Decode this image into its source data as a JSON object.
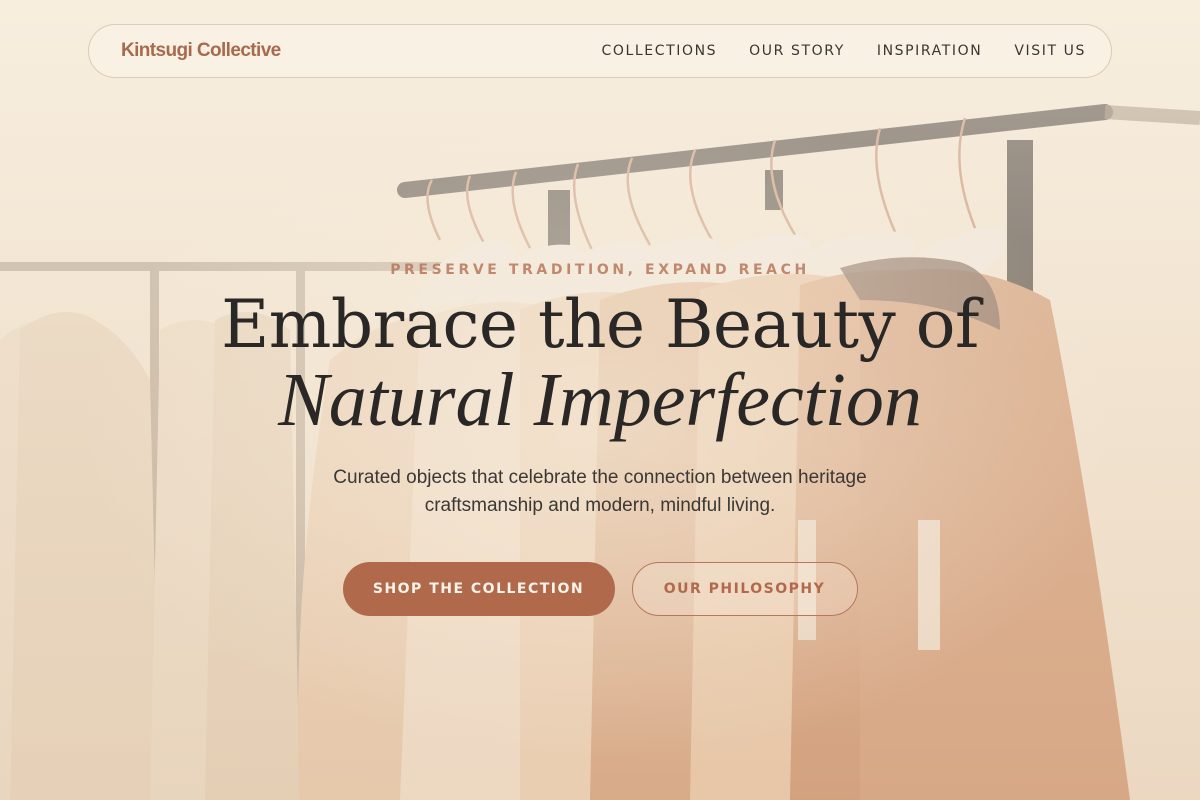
{
  "header": {
    "brand": "Kintsugi Collective",
    "nav": [
      {
        "label": "COLLECTIONS"
      },
      {
        "label": "OUR STORY"
      },
      {
        "label": "INSPIRATION"
      },
      {
        "label": "VISIT US"
      }
    ]
  },
  "hero": {
    "eyebrow": "PRESERVE TRADITION, EXPAND REACH",
    "headline_line1": "Embrace the Beauty of",
    "headline_line2": "Natural Imperfection",
    "subtitle": "Curated objects that celebrate the connection between heritage craftsmanship and modern, mindful living.",
    "primary_cta": "SHOP THE COLLECTION",
    "secondary_cta": "OUR PHILOSOPHY"
  },
  "colors": {
    "accent": "#b06a4b",
    "brand_text": "#a86a4e",
    "headline": "#2a2826",
    "background": "#efe2cf"
  }
}
